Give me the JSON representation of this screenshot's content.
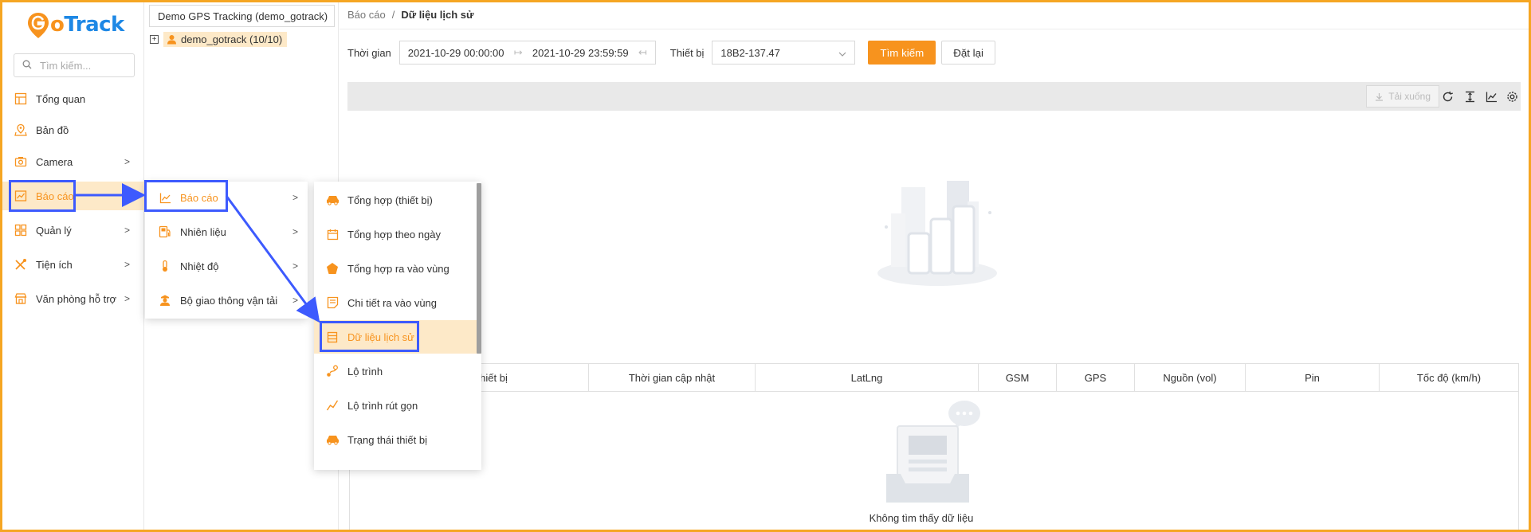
{
  "brand": {
    "logo_text_g": "G",
    "logo_text_o": "o",
    "logo_text_rest": "Track"
  },
  "colors": {
    "accent": "#f7931e",
    "highlight": "#3d5afe",
    "active_bg": "#fde9c8"
  },
  "sidebar": {
    "search_placeholder": "Tìm kiếm...",
    "items": [
      {
        "label": "Tổng quan",
        "icon": "dashboard-icon"
      },
      {
        "label": "Bản đồ",
        "icon": "map-icon"
      },
      {
        "label": "Camera",
        "icon": "camera-icon"
      },
      {
        "label": "Báo cáo",
        "icon": "chart-icon",
        "active": true
      },
      {
        "label": "Quản lý",
        "icon": "grid-icon"
      },
      {
        "label": "Tiện ích",
        "icon": "tools-icon"
      },
      {
        "label": "Văn phòng hỗ trợ",
        "icon": "store-icon"
      }
    ]
  },
  "tree": {
    "account": "Demo GPS Tracking (demo_gotrack)",
    "node_label": "demo_gotrack (10/10)"
  },
  "breadcrumb": {
    "parent": "Báo cáo",
    "separator": "/",
    "current": "Dữ liệu lịch sử"
  },
  "filter": {
    "time_label": "Thời gian",
    "from": "2021-10-29 00:00:00",
    "to": "2021-10-29 23:59:59",
    "device_label": "Thiết bị",
    "device_value": "18B2-137.47",
    "search_button": "Tìm kiếm",
    "reset_button": "Đặt lại"
  },
  "toolbar": {
    "download_label": "Tải xuống"
  },
  "table": {
    "columns": [
      "Thời gian thiết bị",
      "Thời gian cập nhật",
      "LatLng",
      "GSM",
      "GPS",
      "Nguồn (vol)",
      "Pin",
      "Tốc độ (km/h)"
    ],
    "empty_text": "Không tìm thấy dữ liệu"
  },
  "menu1": {
    "items": [
      {
        "label": "Báo cáo",
        "icon": "chart-icon",
        "active": true
      },
      {
        "label": "Nhiên liệu",
        "icon": "fuel-icon"
      },
      {
        "label": "Nhiệt độ",
        "icon": "thermometer-icon"
      },
      {
        "label": "Bộ giao thông vận tải",
        "icon": "officer-icon"
      }
    ]
  },
  "menu2": {
    "items": [
      {
        "label": "Tổng hợp (thiết bị)",
        "icon": "car-icon"
      },
      {
        "label": "Tổng hợp theo ngày",
        "icon": "calendar-icon"
      },
      {
        "label": "Tổng hợp ra vào vùng",
        "icon": "pentagon-icon"
      },
      {
        "label": "Chi tiết ra vào vùng",
        "icon": "document-icon"
      },
      {
        "label": "Dữ liệu lịch sử",
        "icon": "database-icon",
        "active": true
      },
      {
        "label": "Lộ trình",
        "icon": "route-icon"
      },
      {
        "label": "Lộ trình rút gọn",
        "icon": "line-chart-icon"
      },
      {
        "label": "Trạng thái thiết bị",
        "icon": "car-icon"
      }
    ]
  }
}
